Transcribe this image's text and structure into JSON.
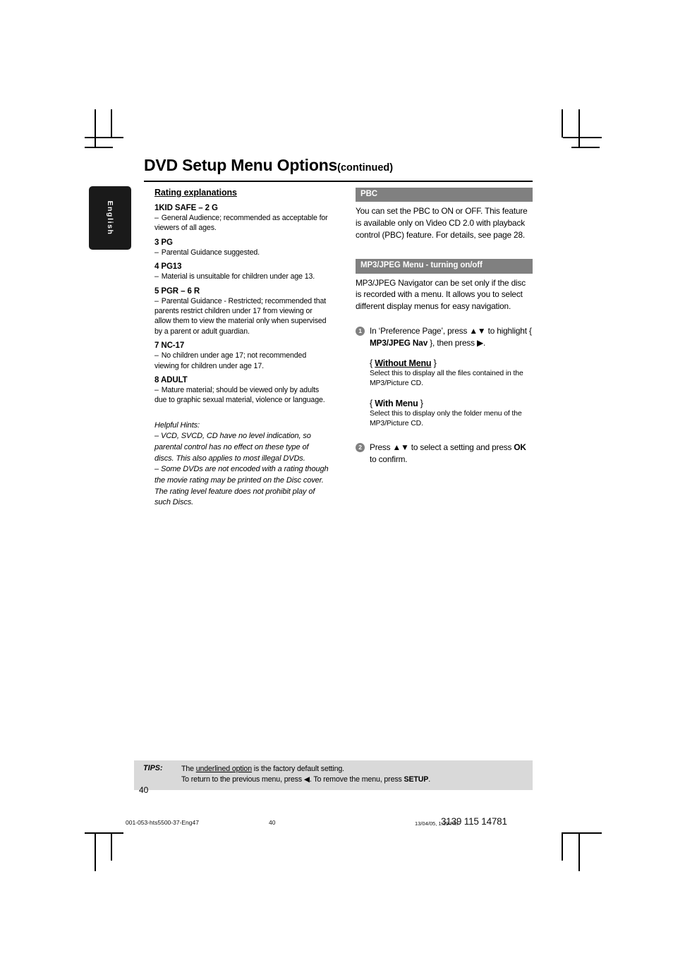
{
  "sidebar": {
    "language_tab": "English"
  },
  "header": {
    "title": "DVD Setup Menu Options",
    "title_suffix": "(continued)"
  },
  "left_column": {
    "heading": "Rating explanations",
    "ratings": [
      {
        "term": "1KID SAFE – 2 G",
        "dash": "–",
        "desc": "General Audience; recommended as acceptable for viewers of all ages."
      },
      {
        "term": "3 PG",
        "dash": "–",
        "desc": "Parental Guidance suggested."
      },
      {
        "term": "4 PG13",
        "dash": "–",
        "desc": "Material is unsuitable for children under age 13."
      },
      {
        "term": "5 PGR – 6 R",
        "dash": "–",
        "desc": "Parental Guidance - Restricted; recommended that parents restrict children under 17 from viewing or allow them to view the material only when supervised by a parent or adult guardian."
      },
      {
        "term": "7 NC-17",
        "dash": "–",
        "desc": "No children under age 17; not recommended viewing for children under age 17."
      },
      {
        "term": "8  ADULT",
        "dash": "–",
        "desc": "Mature material; should be viewed only by adults due to graphic sexual material, violence or language."
      }
    ],
    "hints": {
      "title": "Helpful Hints:",
      "items": [
        "–  VCD, SVCD, CD have no level indication, so parental control has no effect on these type of discs. This also applies to most illegal DVDs.",
        "–  Some DVDs are not encoded with a rating though the movie rating may be printed on the Disc cover. The rating level feature does not prohibit play of such Discs."
      ]
    }
  },
  "right_column": {
    "sections": [
      {
        "head": "PBC",
        "body": "You can set the PBC to ON or OFF.  This feature is available only on Video CD 2.0 with playback control (PBC) feature.  For details, see page 28."
      },
      {
        "head": "MP3/JPEG Menu - turning on/off",
        "body": "MP3/JPEG Navigator can be set only if the disc is recorded with a menu.  It allows you to select different display menus for easy navigation."
      }
    ],
    "steps": [
      {
        "num": "1",
        "text_before": "In ‘Preference Page’, press ",
        "arrows": "▲▼",
        "text_mid": " to highlight { ",
        "bold": "MP3/JPEG Nav",
        "text_after": " }, then press ",
        "arrow_end": "▶",
        "text_end": "."
      },
      {
        "num": "2",
        "text_before": "Press ",
        "arrows": "▲▼",
        "text_mid": "  to select a setting and press ",
        "bold": "OK",
        "text_after": " to confirm.",
        "arrow_end": "",
        "text_end": ""
      }
    ],
    "options": [
      {
        "open_brace": "{ ",
        "label": "Without Menu",
        "close_brace": " }",
        "underlined": true,
        "desc": "Select this to display all the files contained in the MP3/Picture CD."
      },
      {
        "open_brace": "{ ",
        "label": "With Menu",
        "close_brace": " }",
        "underlined": false,
        "desc": "Select this to display only the folder menu of the MP3/Picture CD."
      }
    ]
  },
  "tips": {
    "label": "TIPS:",
    "line1_a": "The ",
    "line1_ul": "underlined option",
    "line1_b": " is the factory default setting.",
    "line2_a": "To return to the previous menu, press ",
    "line2_arrow": "◀",
    "line2_b": ". To remove the menu, press ",
    "line2_bold": "SETUP",
    "line2_c": "."
  },
  "page_number": "40",
  "print_footer": {
    "file": "001-053-hts5500-37-Eng47",
    "page": "40",
    "date": "13/04/05, 1:39 PM",
    "code": "3139 115 14781"
  },
  "colors": {
    "section_header_bg": "#808080",
    "tips_bg": "#d9d9d9",
    "tab_bg": "#1a1a1a"
  }
}
